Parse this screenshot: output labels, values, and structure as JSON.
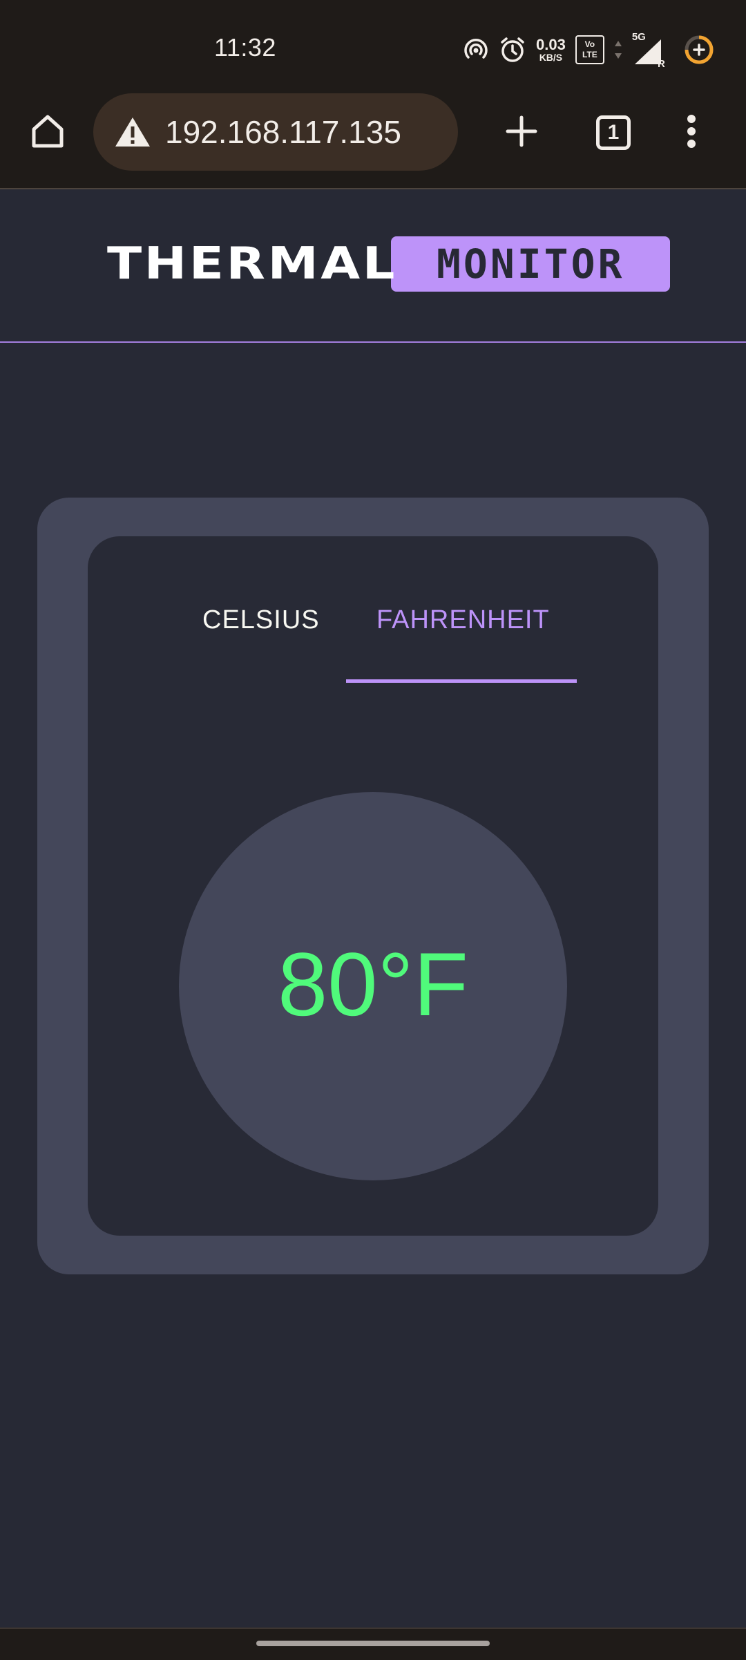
{
  "status_bar": {
    "time": "11:32",
    "net_speed_value": "0.03",
    "net_speed_unit": "KB/S",
    "volte_top": "Vo",
    "volte_bottom": "LTE",
    "signal_label": "5G",
    "roaming_label": "R",
    "icons": [
      "hotspot-icon",
      "alarm-icon",
      "signal-icon",
      "battery-saver-icon"
    ]
  },
  "browser": {
    "url": "192.168.117.135",
    "tab_count": "1",
    "icons": [
      "home-icon",
      "warning-icon",
      "new-tab-icon",
      "tab-switcher-icon",
      "more-menu-icon"
    ]
  },
  "header": {
    "brand_word": "THERMAL",
    "brand_pill": "MONITOR"
  },
  "tabs": {
    "celsius": "CELSIUS",
    "fahrenheit": "FAHRENHEIT",
    "selected": "FAHRENHEIT"
  },
  "reading": {
    "temperature": "80°F"
  },
  "colors": {
    "background": "#272935",
    "card": "#44475a",
    "accent": "#bd93f9",
    "temperature": "#50fa7b",
    "browser_chrome": "#1f1b18",
    "url_bar": "#3b2e25"
  }
}
